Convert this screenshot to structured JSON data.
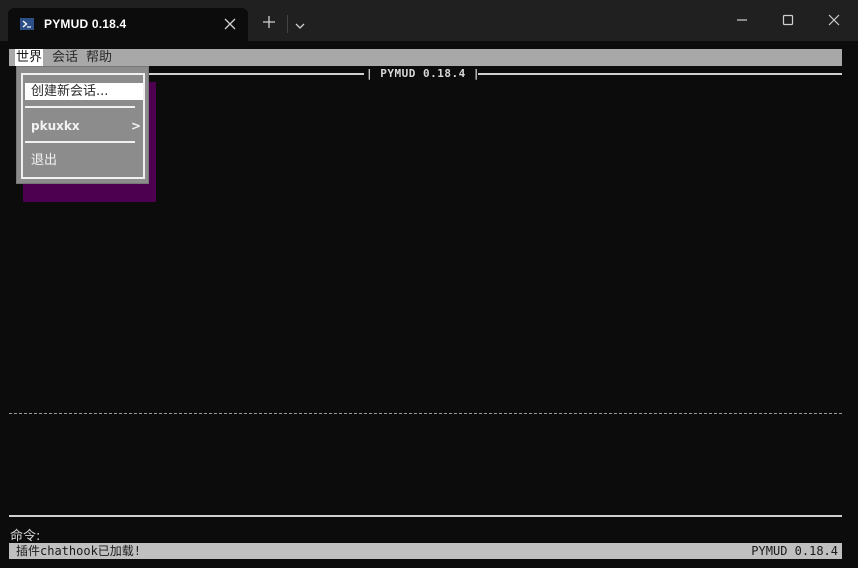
{
  "window": {
    "tab_title": "PYMUD 0.18.4",
    "icons": {
      "tab": "powershell-icon",
      "close_tab": "close-icon",
      "new_tab": "plus-icon",
      "tab_dropdown": "chevron-down-icon",
      "minimize": "minimize-icon",
      "maximize": "maximize-icon",
      "close": "close-icon"
    }
  },
  "menubar": {
    "items": [
      {
        "label": "世界",
        "active": true
      },
      {
        "label": "会话",
        "active": false
      },
      {
        "label": "帮助",
        "active": false
      }
    ]
  },
  "frame": {
    "title": "| PYMUD 0.18.4 |"
  },
  "world_menu": {
    "items": [
      {
        "label": "创建新会话...",
        "selected": true
      },
      {
        "label": "pkuxkx",
        "submenu": true,
        "arrow": ">"
      },
      {
        "label": "退出"
      }
    ]
  },
  "command": {
    "prompt": "命令:"
  },
  "status": {
    "message": "插件chathook已加载!",
    "version": "PYMUD 0.18.4"
  },
  "colors": {
    "background": "#0c0c0c",
    "menubar": "#a8a8a8",
    "menu_popup": "#8c8c8c",
    "menu_shadow": "#4d0050",
    "statusbar": "#c0c0c0"
  }
}
